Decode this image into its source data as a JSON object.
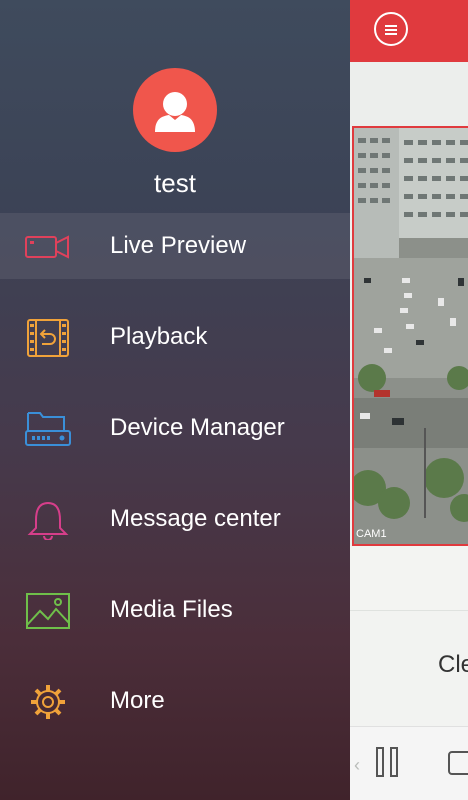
{
  "user": {
    "name": "test"
  },
  "menu": [
    {
      "label": "Live Preview",
      "icon": "camera-icon",
      "color": "#e0415b",
      "active": true
    },
    {
      "label": "Playback",
      "icon": "playback-icon",
      "color": "#f0a23a"
    },
    {
      "label": "Device Manager",
      "icon": "device-manager-icon",
      "color": "#3a8fd8"
    },
    {
      "label": "Message center",
      "icon": "bell-icon",
      "color": "#d63e8a"
    },
    {
      "label": "Media Files",
      "icon": "image-icon",
      "color": "#6fbf4a"
    },
    {
      "label": "More",
      "icon": "gear-icon",
      "color": "#f0a23a"
    }
  ],
  "live_view": {
    "camera_label": "CAM1",
    "clear_text": "Cle"
  },
  "colors": {
    "accent": "#e03a3e"
  }
}
